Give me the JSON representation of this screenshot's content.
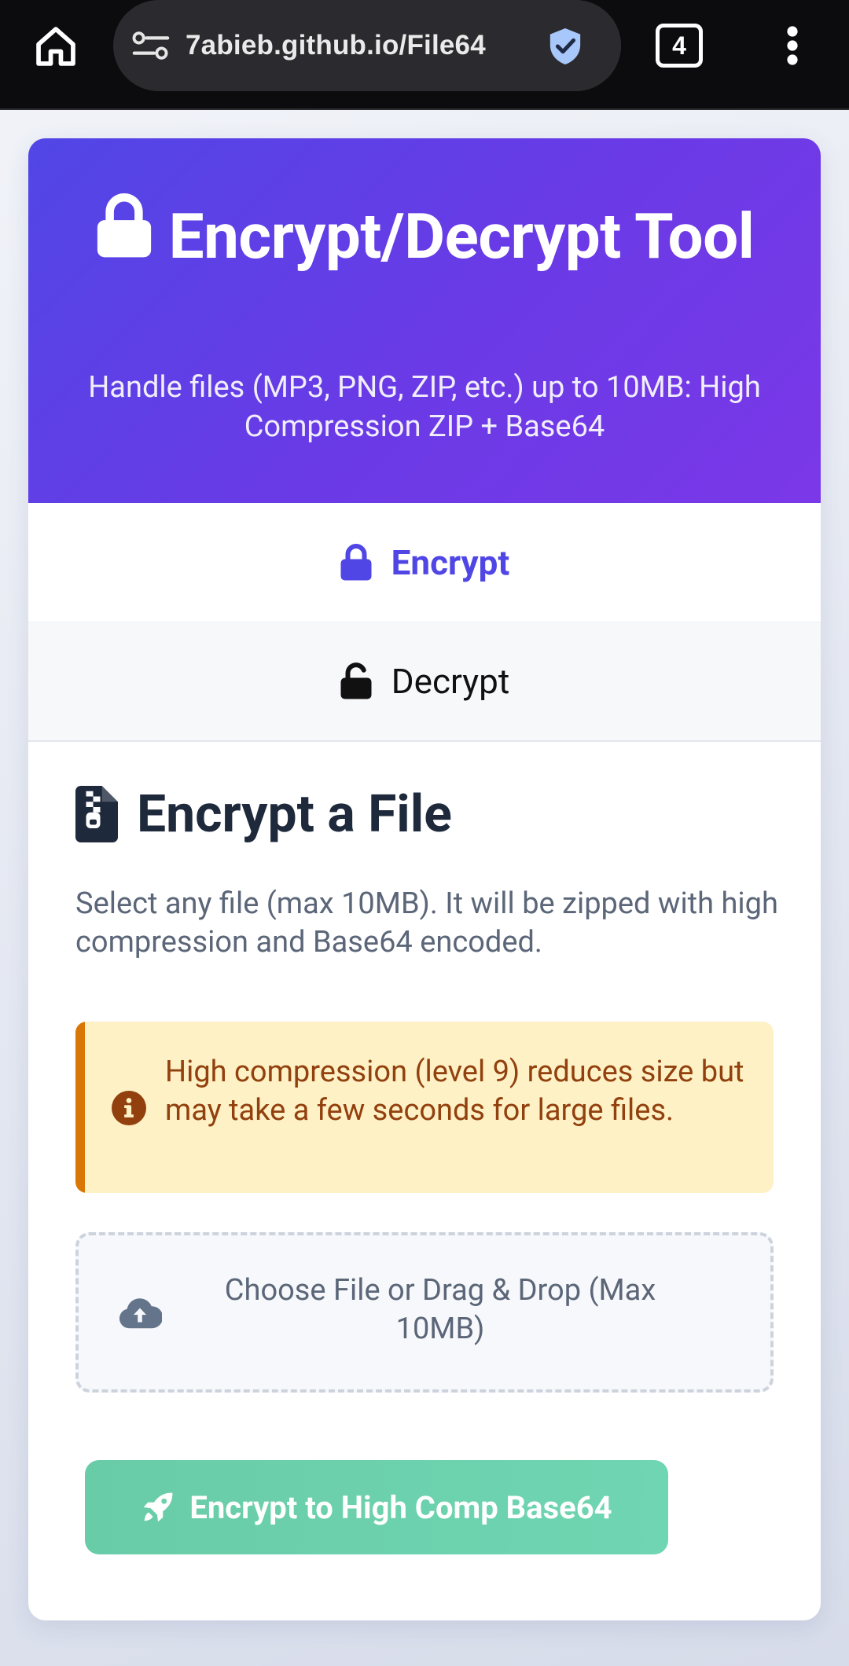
{
  "browser": {
    "url": "7abieb.github.io/File64",
    "tab_count": "4"
  },
  "header": {
    "title": "Encrypt/Decrypt Tool",
    "subtitle": "Handle files (MP3, PNG, ZIP, etc.) up to 10MB: High Compression ZIP + Base64"
  },
  "tabs": [
    {
      "label": "Encrypt",
      "active": true
    },
    {
      "label": "Decrypt",
      "active": false
    }
  ],
  "panel": {
    "title": "Encrypt a File",
    "description": "Select any file (max 10MB). It will be zipped with high compression and Base64 encoded.",
    "notice": "High compression (level 9) reduces size but may take a few seconds for large files.",
    "dropzone_label": "Choose File or Drag & Drop (Max 10MB)",
    "action_label": "Encrypt to High Comp Base64"
  },
  "colors": {
    "accent": "#4f46e5",
    "header_gradient_start": "#5146e6",
    "header_gradient_end": "#7b38e8",
    "notice_bg": "#fdf1c5",
    "notice_border": "#d97706",
    "notice_text": "#92400e",
    "action_button": "#6dd1ad"
  },
  "icons": {
    "home": "home-icon",
    "site_settings": "tune-icon",
    "security": "shield-check-icon",
    "menu": "more-vert-icon",
    "header": "lock-icon",
    "encrypt_tab": "lock-icon",
    "decrypt_tab": "unlock-icon",
    "panel_title": "file-zipper-icon",
    "notice": "info-circle-icon",
    "dropzone": "cloud-upload-icon",
    "action": "rocket-icon"
  }
}
